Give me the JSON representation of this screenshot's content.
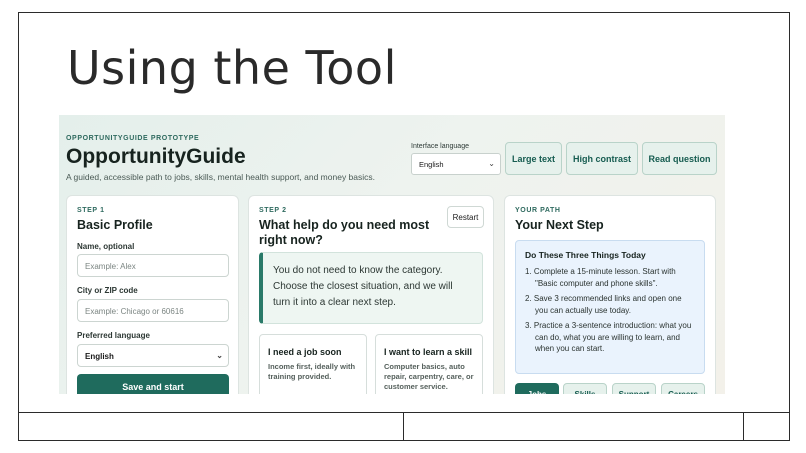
{
  "slide": {
    "title": "Using the Tool"
  },
  "app": {
    "kicker": "OPPORTUNITYGUIDE PROTOTYPE",
    "name": "OpportunityGuide",
    "tagline": "A guided, accessible path to jobs, skills, mental health support, and money basics.",
    "interface_language_label": "Interface language",
    "interface_language_value": "English",
    "buttons": {
      "large_text": "Large text",
      "high_contrast": "High contrast",
      "read_question": "Read question"
    }
  },
  "step1": {
    "kicker": "STEP 1",
    "title": "Basic Profile",
    "name_label": "Name, optional",
    "name_placeholder": "Example: Alex",
    "location_label": "City or ZIP code",
    "location_placeholder": "Example: Chicago or 60616",
    "language_label": "Preferred language",
    "language_value": "English",
    "submit": "Save and start"
  },
  "step2": {
    "kicker": "STEP 2",
    "title_line1": "What help do you need most",
    "title_line2": "right now?",
    "restart": "Restart",
    "note": "You do not need to know the category. Choose the closest situation, and we will turn it into a clear next step.",
    "options": [
      {
        "title": "I need a job soon",
        "desc": "Income first, ideally with training provided."
      },
      {
        "title": "I want to learn a skill",
        "desc": "Computer basics, auto repair, carpentry, care, or customer service."
      }
    ]
  },
  "path": {
    "kicker": "YOUR PATH",
    "title": "Your Next Step",
    "plan_title": "Do These Three Things Today",
    "items": [
      "1. Complete a 15-minute lesson. Start with \"Basic computer and phone skills\".",
      "2. Save 3 recommended links and open one you can actually use today.",
      "3. Practice a 3-sentence introduction: what you can do, what you are willing to learn, and when you can start."
    ],
    "tabs": [
      "Jobs",
      "Skills",
      "Support",
      "Careers"
    ]
  },
  "colors": {
    "accent": "#1f6b5d",
    "accent_soft": "#e6f1ec",
    "plan_bg": "#eaf3fd"
  },
  "icons": {
    "select_chevron": "chevron-down-icon"
  }
}
